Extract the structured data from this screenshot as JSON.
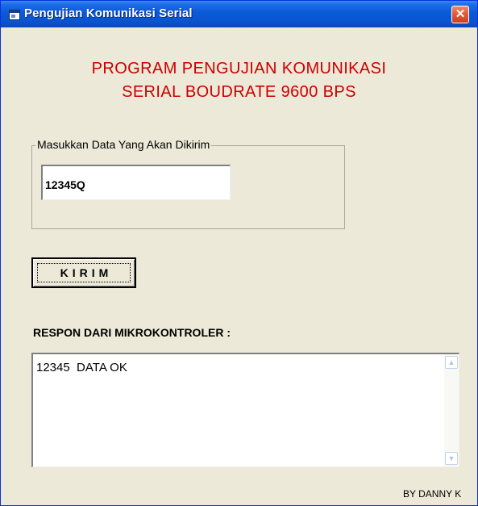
{
  "window": {
    "title": "Pengujian Komunikasi Serial",
    "close_glyph": "✕",
    "colors": {
      "titlebar": "#0a5ad8",
      "close": "#e35a34",
      "background": "#ece9d8"
    }
  },
  "header": {
    "line1": "PROGRAM PENGUJIAN KOMUNIKASI",
    "line2": "SERIAL BOUDRATE 9600 BPS",
    "color": "#cc0000"
  },
  "input_group": {
    "label": "Masukkan Data Yang Akan Dikirim",
    "value": "12345Q"
  },
  "send_button": {
    "label": "KIRIM"
  },
  "response": {
    "label": "RESPON DARI MIKROKONTROLER :",
    "text": "12345  DATA OK",
    "scroll_up_glyph": "▲",
    "scroll_down_glyph": "▼"
  },
  "footer": {
    "signature": "BY DANNY K"
  }
}
